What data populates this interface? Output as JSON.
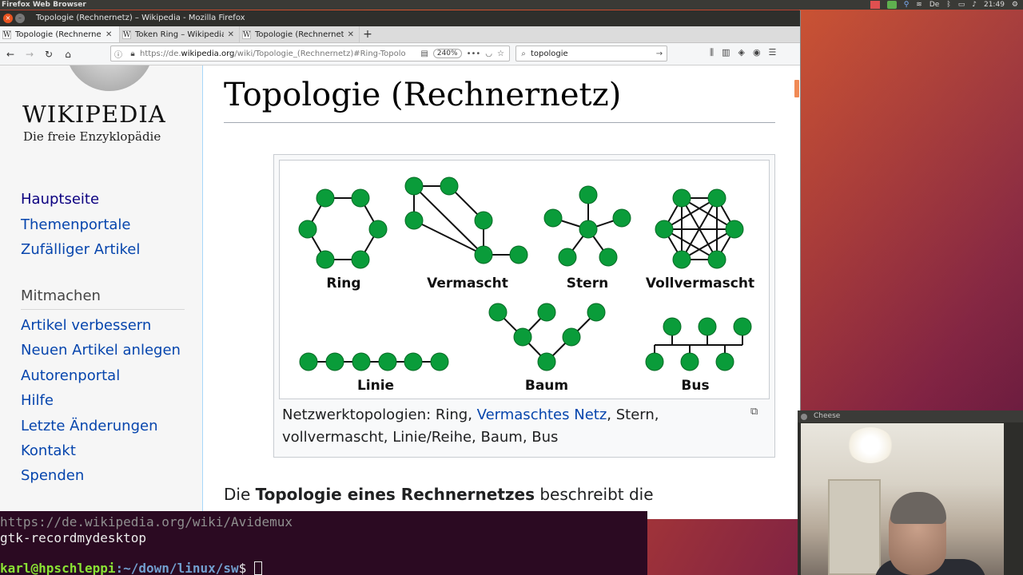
{
  "desktop": {
    "panel_title": "Firefox Web Browser",
    "clock": "21:49"
  },
  "window": {
    "title": "Topologie (Rechnernetz) – Wikipedia - Mozilla Firefox"
  },
  "tabs": [
    {
      "label": "Topologie (Rechnernetz)",
      "active": true
    },
    {
      "label": "Token Ring – Wikipedia",
      "active": false
    },
    {
      "label": "Topologie (Rechnernetz)",
      "active": false
    }
  ],
  "urlbar": {
    "url_prefix": "https://de.",
    "url_domain": "wikipedia.org",
    "url_rest": "/wiki/Topologie_(Rechnernetz)#Ring-Topolo",
    "zoom": "240%"
  },
  "search": {
    "value": "topologie"
  },
  "sidebar": {
    "wordmark": "WIKIPEDIA",
    "tagline": "Die freie Enzyklopädie",
    "nav": [
      "Hauptseite",
      "Themenportale",
      "Zufälliger Artikel"
    ],
    "section": "Mitmachen",
    "contribute": [
      "Artikel verbessern",
      "Neuen Artikel anlegen",
      "Autorenportal",
      "Hilfe",
      "Letzte Änderungen",
      "Kontakt",
      "Spenden"
    ]
  },
  "article": {
    "title": "Topologie (Rechnernetz)",
    "figure_labels": {
      "ring": "Ring",
      "mesh": "Vermascht",
      "star": "Stern",
      "full": "Vollvermascht",
      "line": "Linie",
      "tree": "Baum",
      "bus": "Bus"
    },
    "caption_before": "Netzwerktopologien: Ring, ",
    "caption_link": "Vermaschtes Netz",
    "caption_after": ", Stern, vollvermascht, Linie/Reihe, Baum, Bus",
    "para_plain": "Die ",
    "para_bold": "Topologie eines Rechnernetzes",
    "para_rest": " beschreibt die"
  },
  "terminal": {
    "line1": "https://de.wikipedia.org/wiki/Avidemux",
    "line2": "gtk-recordmydesktop",
    "prompt_user": "karl@hpschleppi",
    "prompt_path": ":~/down/linux/sw",
    "prompt_symbol": "$ "
  },
  "cheese": {
    "title": "Cheese"
  }
}
